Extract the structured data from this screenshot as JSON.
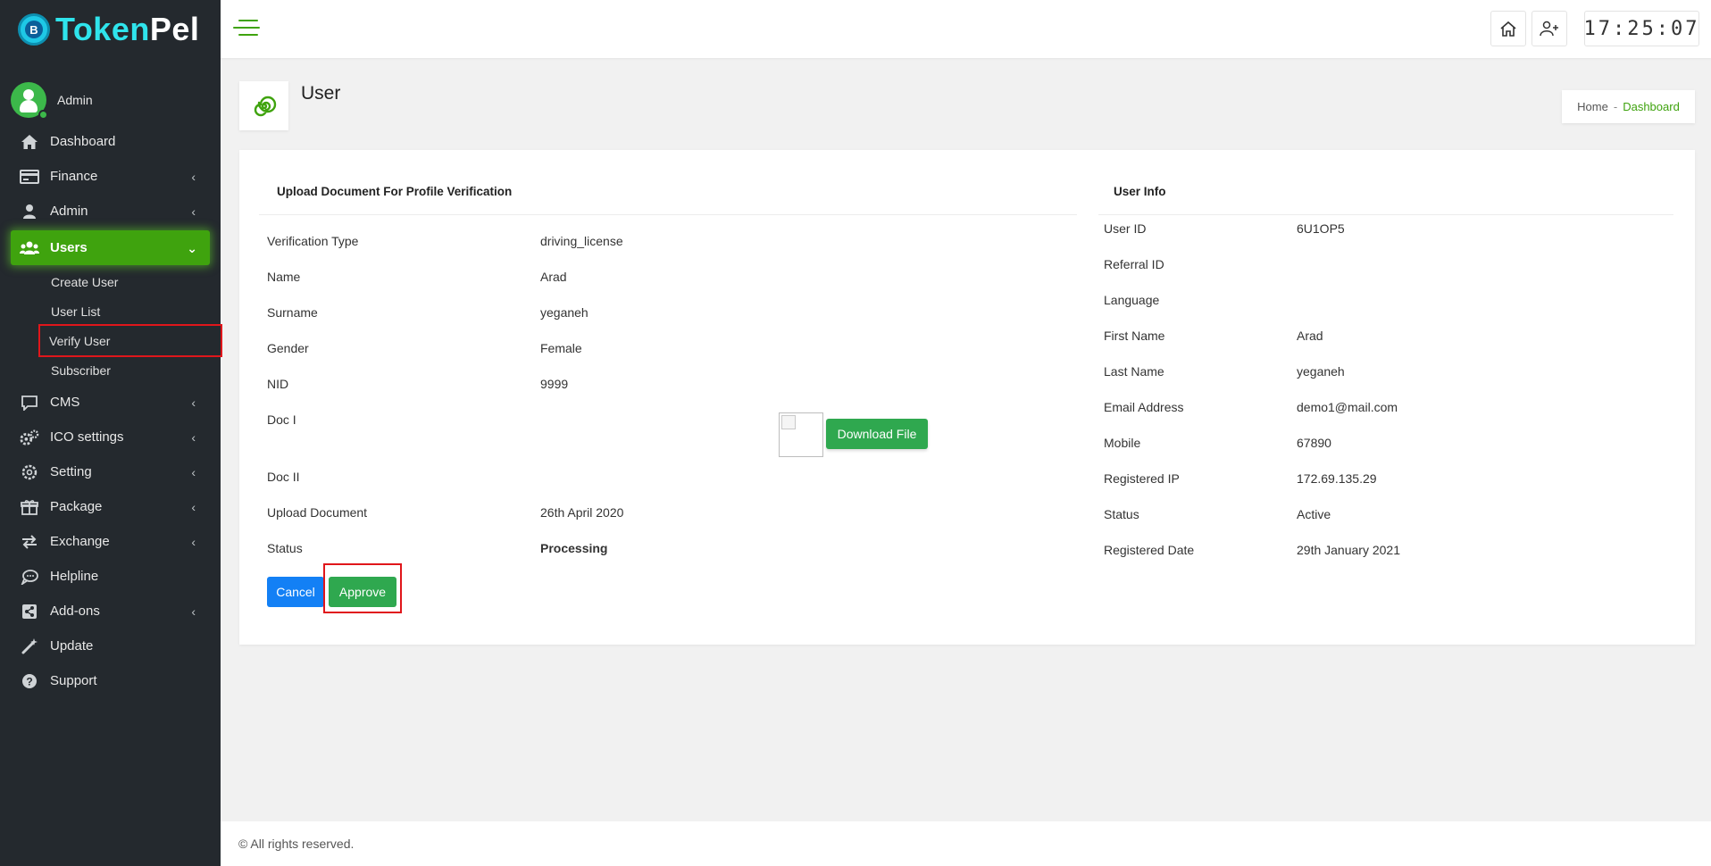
{
  "brand": {
    "part1": "Token",
    "part2": "Pel",
    "coin_glyph": "B"
  },
  "sidebar": {
    "admin_name": "Admin",
    "items": [
      {
        "label": "Dashboard",
        "icon": "home-icon",
        "has_children": false
      },
      {
        "label": "Finance",
        "icon": "card-icon",
        "has_children": true
      },
      {
        "label": "Admin",
        "icon": "user-icon",
        "has_children": true
      },
      {
        "label": "Users",
        "icon": "users-icon",
        "has_children": true,
        "active": true
      },
      {
        "label": "CMS",
        "icon": "comment-icon",
        "has_children": true
      },
      {
        "label": "ICO settings",
        "icon": "gears-icon",
        "has_children": true
      },
      {
        "label": "Setting",
        "icon": "gear-icon",
        "has_children": true
      },
      {
        "label": "Package",
        "icon": "gift-icon",
        "has_children": true
      },
      {
        "label": "Exchange",
        "icon": "exchange-icon",
        "has_children": true
      },
      {
        "label": "Helpline",
        "icon": "chat-icon",
        "has_children": false
      },
      {
        "label": "Add-ons",
        "icon": "share-icon",
        "has_children": true
      },
      {
        "label": "Update",
        "icon": "wand-icon",
        "has_children": false
      },
      {
        "label": "Support",
        "icon": "question-icon",
        "has_children": false
      }
    ],
    "users_submenu": [
      "Create User",
      "User List",
      "Verify User",
      "Subscriber"
    ]
  },
  "header": {
    "clock": "17:25:07",
    "home_icon": "home-outline-icon",
    "add_user_icon": "user-plus-icon"
  },
  "page": {
    "title": "User"
  },
  "breadcrumb": {
    "home": "Home",
    "separator": "-",
    "current": "Dashboard"
  },
  "verification": {
    "title": "Upload Document For Profile Verification",
    "rows": [
      {
        "label": "Verification Type",
        "value": "driving_license"
      },
      {
        "label": "Name",
        "value": "Arad"
      },
      {
        "label": "Surname",
        "value": "yeganeh"
      },
      {
        "label": "Gender",
        "value": "Female"
      },
      {
        "label": "NID",
        "value": "9999"
      },
      {
        "label": "Doc I",
        "value": ""
      },
      {
        "label": "Doc II",
        "value": ""
      },
      {
        "label": "Upload Document",
        "value": "26th April 2020"
      },
      {
        "label": "Status",
        "value": "Processing"
      }
    ],
    "download_label": "Download File",
    "cancel_label": "Cancel",
    "approve_label": "Approve"
  },
  "user_info": {
    "title": "User Info",
    "rows": [
      {
        "label": "User ID",
        "value": "6U1OP5"
      },
      {
        "label": "Referral ID",
        "value": ""
      },
      {
        "label": "Language",
        "value": ""
      },
      {
        "label": "First Name",
        "value": "Arad"
      },
      {
        "label": "Last Name",
        "value": "yeganeh"
      },
      {
        "label": "Email Address",
        "value": "demo1@mail.com"
      },
      {
        "label": "Mobile",
        "value": "67890"
      },
      {
        "label": "Registered IP",
        "value": "172.69.135.29"
      },
      {
        "label": "Status",
        "value": "Active"
      },
      {
        "label": "Registered Date",
        "value": "29th January 2021"
      }
    ]
  },
  "footer": {
    "text": "© All rights reserved."
  },
  "colors": {
    "sidebar_bg": "#24292e",
    "accent_green": "#3fa30e",
    "primary_blue": "#1380f5",
    "success_green": "#2fa84f",
    "highlight_red": "#e0161b"
  }
}
